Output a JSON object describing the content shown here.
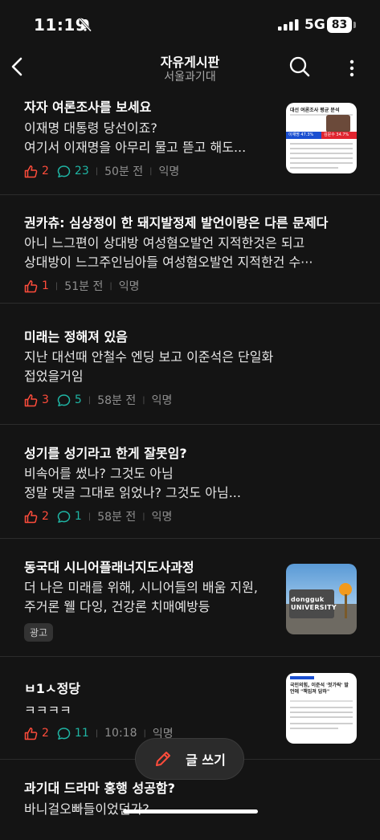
{
  "status": {
    "time": "11:19",
    "network": "5G",
    "battery": "83"
  },
  "header": {
    "title": "자유게시판",
    "subtitle": "서울과기대"
  },
  "posts": [
    {
      "title": "자자 여론조사를 보세요",
      "lines": [
        "이재명 대통령 당선이죠?",
        "여기서 이재명을 아무리 물고 뜯고 해도..."
      ],
      "likes": "2",
      "comments": "23",
      "time": "50분 전",
      "author": "익명"
    },
    {
      "title": "권카츄: 심상정이 한 돼지발정제 발언이랑은 다른 문제다",
      "lines": [
        "아니 느그편이 상대방 여성혐오발언 지적한것은 되고",
        "상대방이 느그주인님아들 여성혐오발언 지적한건 수···"
      ],
      "likes": "1",
      "time": "51분 전",
      "author": "익명"
    },
    {
      "title": "미래는 정해져 있음",
      "lines": [
        "지난 대선때 안철수 엔딩 보고 이준석은 단일화",
        "접었을거임"
      ],
      "likes": "3",
      "comments": "5",
      "time": "58분 전",
      "author": "익명"
    },
    {
      "title": "성기를 성기라고 한게 잘못임?",
      "lines": [
        "비속어를 썼나? 그것도 아님",
        "정말 댓글 그대로 읽었나? 그것도 아님..."
      ],
      "likes": "2",
      "comments": "1",
      "time": "58분 전",
      "author": "익명"
    },
    {
      "title": "동국대 시니어플래너지도사과정",
      "lines": [
        "더 나은 미래를 위해, 시니어들의 배움 지원,",
        "주거론 웰 다잉, 건강론 치매예방등"
      ],
      "badge": "광고",
      "ad_image_text": "dongguk UNIVERSITY"
    },
    {
      "title": "ㅂ1ㅅ정당",
      "lines": [
        "ㅋㅋㅋㅋ"
      ],
      "likes": "2",
      "comments": "11",
      "time": "10:18",
      "author": "익명"
    },
    {
      "title": "과기대 드라마 홍행 성공함?",
      "lines": [
        "바니걸오빠들이었던가?"
      ]
    }
  ],
  "write_button": {
    "label": "글 쓰기"
  },
  "thumb1": {
    "headline": "대선 여론조사 평균 분석",
    "left": "이재명 47.3%",
    "right": "김문수 34.7%"
  },
  "thumb6": {
    "headline": "국민의힘, 이준석 '젓가락' 발언에 \"책임져 답하\""
  },
  "colors": {
    "background": "#141414",
    "like": "#ff4c3b",
    "comment": "#1fb5a4",
    "meta": "#8f8f8f"
  }
}
